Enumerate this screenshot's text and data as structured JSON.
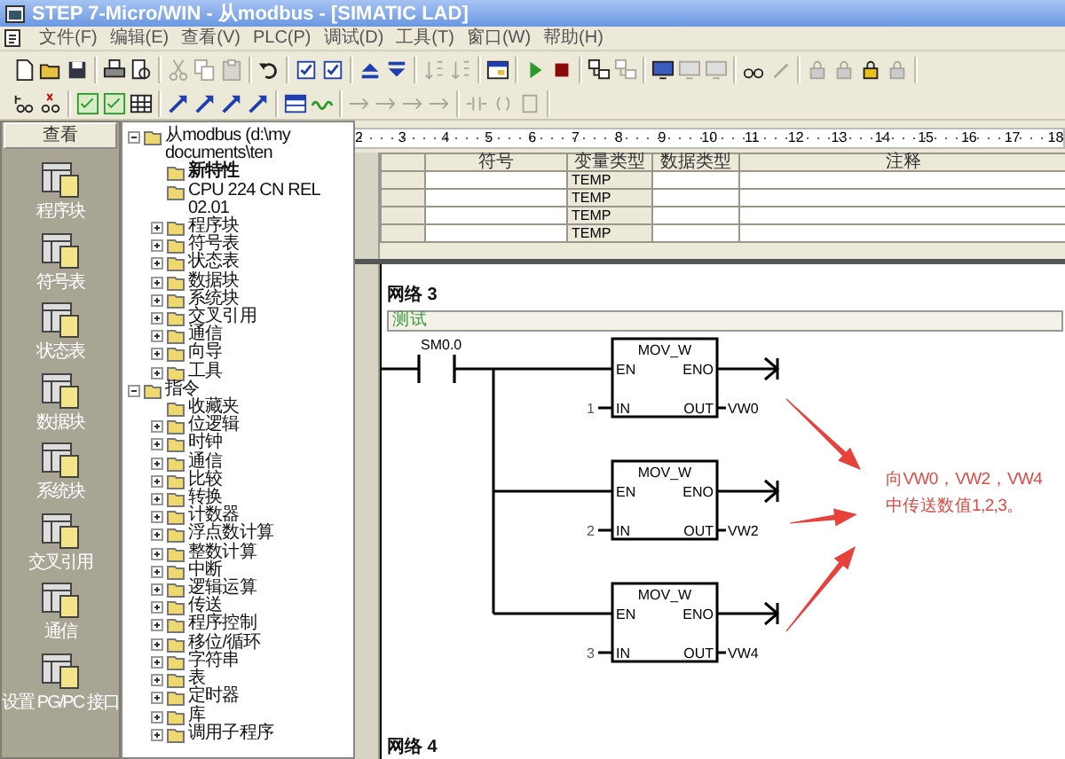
{
  "window": {
    "title": "STEP 7-Micro/WIN - 从modbus - [SIMATIC LAD]"
  },
  "menu": [
    "文件(F)",
    "编辑(E)",
    "查看(V)",
    "PLC(P)",
    "调试(D)",
    "工具(T)",
    "窗口(W)",
    "帮助(H)"
  ],
  "toolbars": [
    {
      "groups": [
        [
          {
            "kind": "doc",
            "disabled": false
          },
          {
            "kind": "folder",
            "disabled": false
          },
          {
            "kind": "disk",
            "disabled": false
          }
        ],
        [
          {
            "kind": "printer",
            "disabled": false
          },
          {
            "kind": "preview",
            "disabled": false
          }
        ],
        [
          {
            "kind": "scissors",
            "disabled": true
          },
          {
            "kind": "copy",
            "disabled": true
          },
          {
            "kind": "paste",
            "disabled": true
          }
        ],
        [
          {
            "kind": "undo",
            "disabled": false
          }
        ],
        [
          {
            "kind": "check",
            "disabled": false
          },
          {
            "kind": "check",
            "disabled": false
          }
        ],
        [
          {
            "kind": "up",
            "disabled": false
          },
          {
            "kind": "down",
            "disabled": false
          }
        ],
        [
          {
            "kind": "sort",
            "disabled": true
          },
          {
            "kind": "sort",
            "disabled": true
          }
        ],
        [
          {
            "kind": "window",
            "disabled": false
          }
        ],
        [
          {
            "kind": "play",
            "disabled": false
          },
          {
            "kind": "stop",
            "disabled": false
          }
        ],
        [
          {
            "kind": "network",
            "disabled": false
          },
          {
            "kind": "network",
            "disabled": true
          }
        ],
        [
          {
            "kind": "monitor",
            "disabled": false
          },
          {
            "kind": "monitor",
            "disabled": true
          },
          {
            "kind": "monitor",
            "disabled": true
          }
        ],
        [
          {
            "kind": "glasses",
            "disabled": false
          },
          {
            "kind": "pen",
            "disabled": true
          }
        ],
        [
          {
            "kind": "lock",
            "disabled": true
          },
          {
            "kind": "lock",
            "disabled": true
          },
          {
            "kind": "lock",
            "disabled": false
          },
          {
            "kind": "lock",
            "disabled": true
          }
        ]
      ]
    },
    {
      "groups": [
        [
          {
            "kind": "step",
            "disabled": false
          },
          {
            "kind": "halt",
            "disabled": false
          }
        ],
        [
          {
            "kind": "sheet",
            "disabled": false
          },
          {
            "kind": "sheet",
            "disabled": false
          },
          {
            "kind": "grid",
            "disabled": false
          }
        ],
        [
          {
            "kind": "branch",
            "disabled": false
          },
          {
            "kind": "branch",
            "disabled": false
          },
          {
            "kind": "branch",
            "disabled": false
          },
          {
            "kind": "branch",
            "disabled": false
          }
        ],
        [
          {
            "kind": "table",
            "disabled": false
          },
          {
            "kind": "symbol",
            "disabled": false
          }
        ],
        [
          {
            "kind": "wire",
            "disabled": true
          },
          {
            "kind": "wire",
            "disabled": true
          },
          {
            "kind": "wire",
            "disabled": true
          },
          {
            "kind": "wire",
            "disabled": true
          }
        ],
        [
          {
            "kind": "contact",
            "disabled": true
          },
          {
            "kind": "coil",
            "disabled": true
          },
          {
            "kind": "box",
            "disabled": true
          }
        ]
      ]
    }
  ],
  "navigation": {
    "header": "查看",
    "items": [
      "程序块",
      "符号表",
      "状态表",
      "数据块",
      "系统块",
      "交叉引用",
      "通信",
      "设置 PG/PC 接口"
    ]
  },
  "tree": [
    {
      "label": "从modbus (d:\\my documents\\ten",
      "expanded": true,
      "children": [
        {
          "label": "新特性",
          "bold": true
        },
        {
          "label": "CPU 224 CN REL 02.01"
        },
        {
          "label": "程序块",
          "expanded": false
        },
        {
          "label": "符号表",
          "expanded": false
        },
        {
          "label": "状态表",
          "expanded": false
        },
        {
          "label": "数据块",
          "expanded": false
        },
        {
          "label": "系统块",
          "expanded": false
        },
        {
          "label": "交叉引用",
          "expanded": false
        },
        {
          "label": "通信",
          "expanded": false
        },
        {
          "label": "向导",
          "expanded": false
        },
        {
          "label": "工具",
          "expanded": false
        }
      ]
    },
    {
      "label": "指令",
      "expanded": true,
      "children": [
        {
          "label": "收藏夹"
        },
        {
          "label": "位逻辑",
          "expanded": false
        },
        {
          "label": "时钟",
          "expanded": false
        },
        {
          "label": "通信",
          "expanded": false
        },
        {
          "label": "比较",
          "expanded": false
        },
        {
          "label": "转换",
          "expanded": false
        },
        {
          "label": "计数器",
          "expanded": false
        },
        {
          "label": "浮点数计算",
          "expanded": false
        },
        {
          "label": "整数计算",
          "expanded": false
        },
        {
          "label": "中断",
          "expanded": false
        },
        {
          "label": "逻辑运算",
          "expanded": false
        },
        {
          "label": "传送",
          "expanded": false
        },
        {
          "label": "程序控制",
          "expanded": false
        },
        {
          "label": "移位/循环",
          "expanded": false
        },
        {
          "label": "字符串",
          "expanded": false
        },
        {
          "label": "表",
          "expanded": false
        },
        {
          "label": "定时器",
          "expanded": false
        },
        {
          "label": "库",
          "expanded": false
        },
        {
          "label": "调用子程序",
          "expanded": false
        }
      ]
    }
  ],
  "ruler": [
    "2",
    "3",
    "4",
    "5",
    "6",
    "7",
    "8",
    "9",
    "10",
    "11",
    "12",
    "13",
    "14",
    "15",
    "16",
    "17",
    "18"
  ],
  "variable_table": {
    "columns": [
      "符号",
      "变量类型",
      "数据类型",
      "注释"
    ],
    "rows": [
      {
        "var_type": "TEMP"
      },
      {
        "var_type": "TEMP"
      },
      {
        "var_type": "TEMP"
      },
      {
        "var_type": "TEMP"
      }
    ]
  },
  "network_3": {
    "title": "网络 3",
    "comment": "测试",
    "contact": "SM0.0",
    "blocks": [
      {
        "title": "MOV_W",
        "en": "EN",
        "eno": "ENO",
        "in_label": "IN",
        "out_label": "OUT",
        "in_value": "1",
        "out_value": "VW0"
      },
      {
        "title": "MOV_W",
        "en": "EN",
        "eno": "ENO",
        "in_label": "IN",
        "out_label": "OUT",
        "in_value": "2",
        "out_value": "VW2"
      },
      {
        "title": "MOV_W",
        "en": "EN",
        "eno": "ENO",
        "in_label": "IN",
        "out_label": "OUT",
        "in_value": "3",
        "out_value": "VW4"
      }
    ]
  },
  "annotation": {
    "lines": [
      "向VW0，VW2，VW4",
      "中传送数值1,2,3。"
    ]
  },
  "network_4": {
    "title": "网络 4"
  }
}
